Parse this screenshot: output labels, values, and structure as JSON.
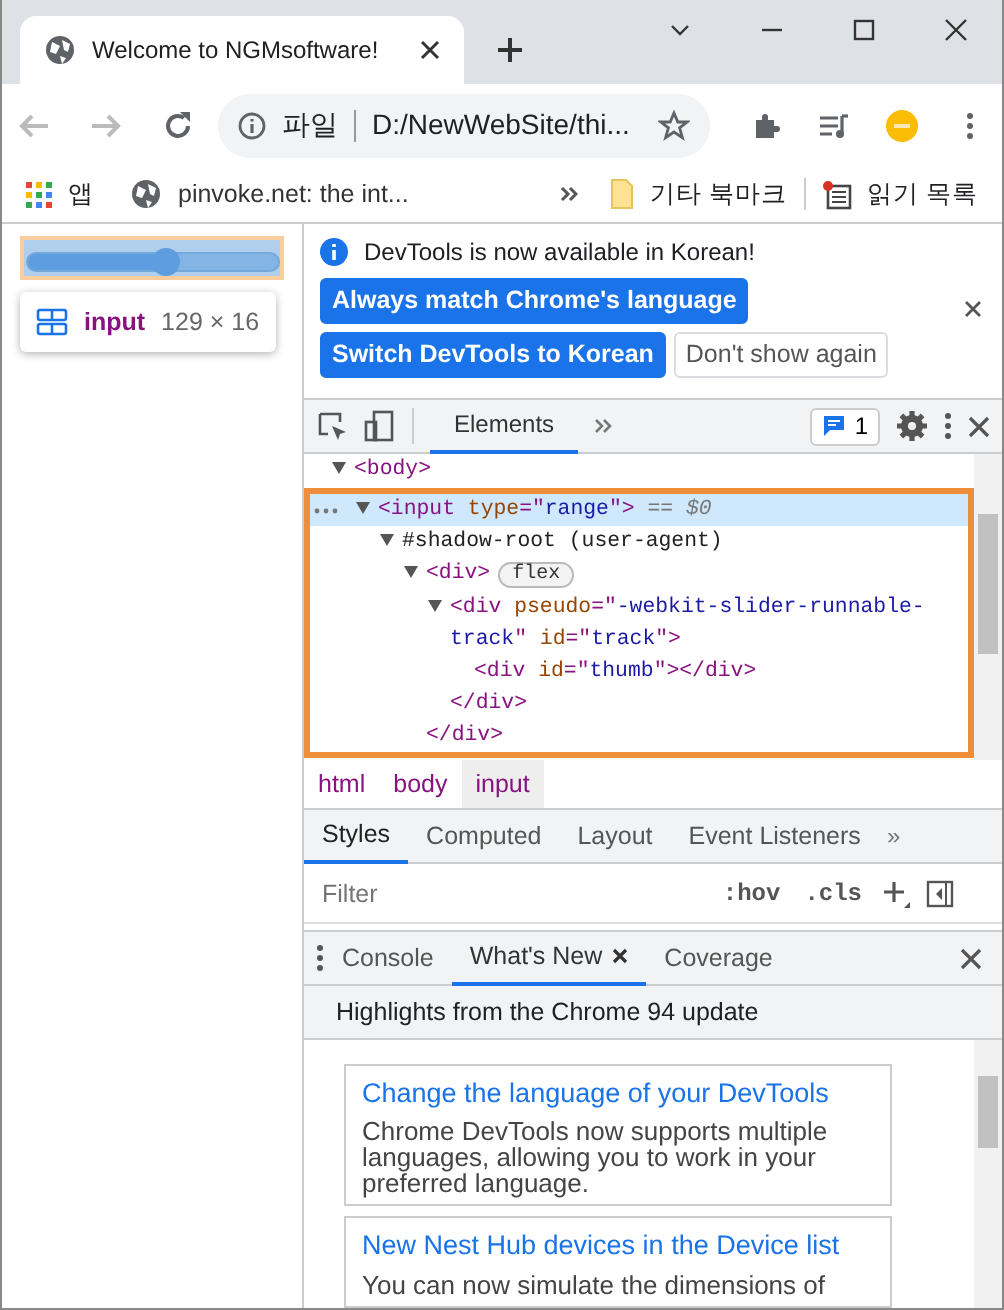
{
  "browser_tab": {
    "title": "Welcome to NGMsoftware!"
  },
  "address_bar": {
    "scheme": "파일",
    "url": "D:/NewWebSite/thi..."
  },
  "bookmarks": [
    {
      "label": "앱",
      "kind": "apps"
    },
    {
      "label": "pinvoke.net: the int...",
      "kind": "site"
    }
  ],
  "other_bookmarks": "기타 북마크",
  "reading_list": "읽기 목록",
  "page": {
    "slider": {
      "level": 0.55
    },
    "tooltip": {
      "tag": "input",
      "size": "129 × 16"
    }
  },
  "devtools": {
    "infobar": {
      "message": "DevTools is now available in Korean!",
      "buttons": [
        {
          "label": "Always match Chrome's language",
          "kind": "primary"
        },
        {
          "label": "Switch DevTools to Korean",
          "kind": "primary"
        },
        {
          "label": "Don't show again",
          "kind": "plain"
        }
      ]
    },
    "panel_tabs": [
      {
        "label": "Elements",
        "selected": true
      }
    ],
    "issues_count": "1",
    "dom_tree": [
      {
        "tokens": [
          {
            "kind": "tag",
            "s": "<body>"
          }
        ],
        "expanded": true,
        "selected": false,
        "children": [
          {
            "tokens": [
              {
                "kind": "tag",
                "s": "<input "
              },
              {
                "kind": "attr",
                "s": "type"
              },
              {
                "kind": "tag",
                "s": "=\""
              },
              {
                "kind": "value",
                "s": "range"
              },
              {
                "kind": "tag",
                "s": "\">"
              },
              {
                "kind": "note",
                "s": " == $0"
              }
            ],
            "expanded": true,
            "selected": true,
            "children": [
              {
                "tokens": [
                  {
                    "kind": "plain",
                    "s": "#shadow-root (user-agent)"
                  }
                ],
                "expanded": true,
                "selected": false,
                "children": [
                  {
                    "tokens": [
                      {
                        "kind": "tag",
                        "s": "<div>"
                      },
                      {
                        "kind": "badge",
                        "s": "flex"
                      }
                    ],
                    "expanded": true,
                    "selected": false,
                    "close": "</div>",
                    "children": [
                      {
                        "tokens": [
                          {
                            "kind": "tag",
                            "s": "<div "
                          },
                          {
                            "kind": "attr",
                            "s": "pseudo"
                          },
                          {
                            "kind": "tag",
                            "s": "=\""
                          },
                          {
                            "kind": "value",
                            "s": "-webkit-slider-runnable-track"
                          },
                          {
                            "kind": "tag",
                            "s": "\" "
                          },
                          {
                            "kind": "attr",
                            "s": "id"
                          },
                          {
                            "kind": "tag",
                            "s": "=\""
                          },
                          {
                            "kind": "value",
                            "s": "track"
                          },
                          {
                            "kind": "tag",
                            "s": "\">"
                          }
                        ],
                        "expanded": true,
                        "selected": false,
                        "close": "</div>",
                        "children": [
                          {
                            "tokens": [
                              {
                                "kind": "tag",
                                "s": "<div "
                              },
                              {
                                "kind": "attr",
                                "s": "id"
                              },
                              {
                                "kind": "tag",
                                "s": "=\""
                              },
                              {
                                "kind": "value",
                                "s": "thumb"
                              },
                              {
                                "kind": "tag",
                                "s": "\"></div>"
                              }
                            ],
                            "selected": false
                          }
                        ]
                      }
                    ]
                  }
                ]
              }
            ]
          }
        ]
      }
    ],
    "breadcrumbs": [
      {
        "label": "html",
        "selected": false
      },
      {
        "label": "body",
        "selected": false
      },
      {
        "label": "input",
        "selected": true
      }
    ],
    "sidebar_tabs": [
      {
        "label": "Styles",
        "selected": true
      },
      {
        "label": "Computed",
        "selected": false
      },
      {
        "label": "Layout",
        "selected": false
      },
      {
        "label": "Event Listeners",
        "selected": false
      }
    ],
    "sidebar_more": "»",
    "filter": {
      "placeholder": "Filter"
    },
    "filter_buttons": [
      ":hov",
      ".cls"
    ],
    "drawer_tabs": [
      {
        "label": "Console",
        "selected": false,
        "closable": false
      },
      {
        "label": "What's New",
        "selected": true,
        "closable": true
      },
      {
        "label": "Coverage",
        "selected": false,
        "closable": false
      }
    ],
    "whats_new": {
      "heading": "Highlights from the Chrome 94 update",
      "cards": [
        {
          "title": "Change the language of your DevTools",
          "text": "Chrome DevTools now supports multiple languages, allowing you to work in your preferred language."
        },
        {
          "title": "New Nest Hub devices in the Device list",
          "text": "You can now simulate the dimensions of"
        }
      ]
    }
  }
}
